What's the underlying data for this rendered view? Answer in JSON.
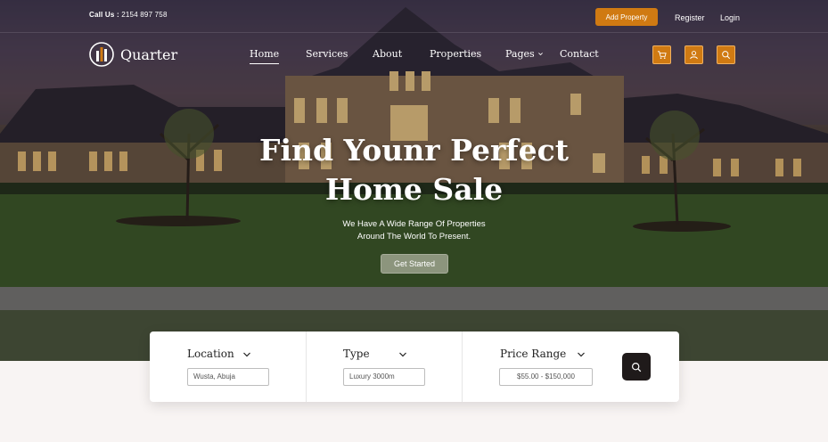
{
  "topbar": {
    "call_label": "Call Us :",
    "call_number": "2154 897 758",
    "add_property": "Add Property",
    "register": "Register",
    "login": "Login"
  },
  "brand": {
    "name": "Quarter"
  },
  "nav": {
    "items": [
      {
        "label": "Home",
        "active": true
      },
      {
        "label": "Services"
      },
      {
        "label": "About"
      },
      {
        "label": "Properties"
      },
      {
        "label": "Pages",
        "has_dropdown": true
      },
      {
        "label": "Contact"
      }
    ]
  },
  "header_icons": [
    "cart-icon",
    "user-icon",
    "search-icon"
  ],
  "hero": {
    "title_line1": "Find Younr Perfect",
    "title_line2": "Home Sale",
    "subtitle_line1": "We Have A Wide Range Of Properties",
    "subtitle_line2": "Around The World To Present.",
    "cta": "Get Started"
  },
  "search": {
    "location": {
      "label": "Location",
      "value": "Wusta, Abuja"
    },
    "type": {
      "label": "Type",
      "value": "Luxury 3000m"
    },
    "price": {
      "label": "Price Range",
      "value": "$55.00 - $150,000"
    }
  },
  "colors": {
    "accent": "#d07a12",
    "dark": "#1f1a1a",
    "cta": "#8c957d"
  }
}
